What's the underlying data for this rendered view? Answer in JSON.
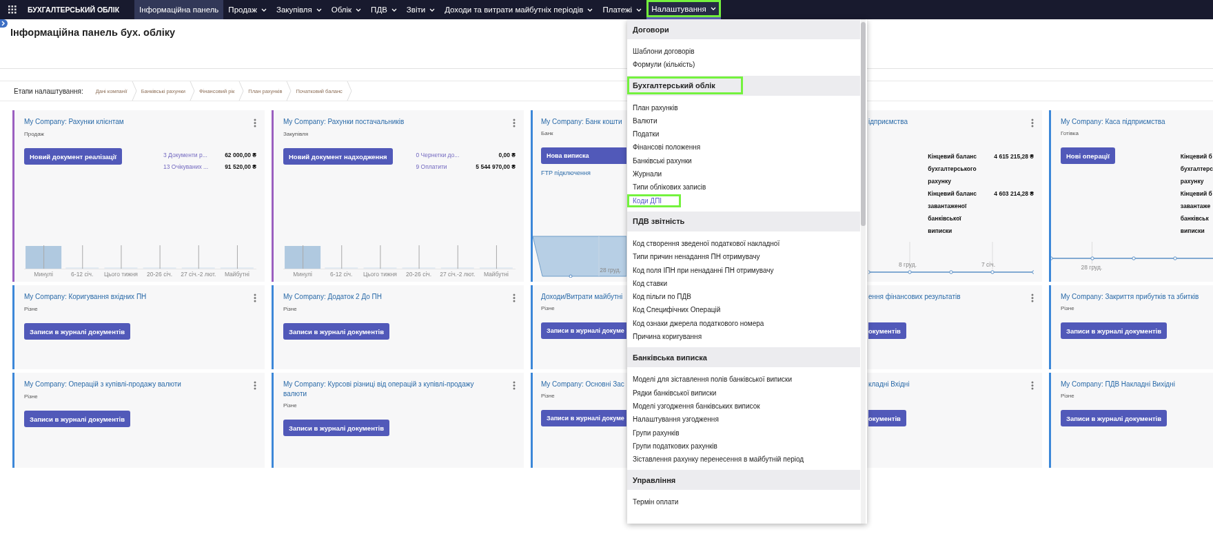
{
  "navbar": {
    "brand": "БУХГАЛТЕРСЬКИЙ ОБЛІК",
    "items": [
      {
        "label": "Інформаційна панель",
        "selected": true,
        "open": false,
        "dropdown": false,
        "highlighted": false
      },
      {
        "label": "Продаж",
        "selected": false,
        "open": false,
        "dropdown": true,
        "highlighted": false
      },
      {
        "label": "Закупівля",
        "selected": false,
        "open": false,
        "dropdown": true,
        "highlighted": false
      },
      {
        "label": "Облік",
        "selected": false,
        "open": false,
        "dropdown": true,
        "highlighted": false
      },
      {
        "label": "ПДВ",
        "selected": false,
        "open": false,
        "dropdown": true,
        "highlighted": false
      },
      {
        "label": "Звіти",
        "selected": false,
        "open": false,
        "dropdown": true,
        "highlighted": false
      },
      {
        "label": "Доходи та витрати майбутніх періодів",
        "selected": false,
        "open": false,
        "dropdown": true,
        "highlighted": false
      },
      {
        "label": "Платежі",
        "selected": false,
        "open": false,
        "dropdown": true,
        "highlighted": false
      },
      {
        "label": "Налаштування",
        "selected": false,
        "open": true,
        "dropdown": true,
        "highlighted": true
      }
    ]
  },
  "header": {
    "title": "Інформаційна панель бух. обліку"
  },
  "setup_steps": {
    "label": "Етапи налаштування:",
    "steps": [
      "Дані компанії",
      "Банківські рахунки",
      "Фінансовий рік",
      "План рахунків",
      "Початковий баланс"
    ]
  },
  "cards": [
    {
      "kind": "sales",
      "title": "My Company: Рахунки клієнтам",
      "subtitle": "Продаж",
      "color": "#9b5fc0",
      "menu": true,
      "button": "Новий документ реалізації",
      "links": [
        {
          "label": "3 Документи р...",
          "amount": "62 000,00 ₴"
        },
        {
          "label": "13 Очікуваних ...",
          "amount": "91 520,00 ₴"
        }
      ],
      "chart_labels": [
        "Минулі",
        "6-12 січ.",
        "Цього тижня",
        "20-26 січ.",
        "27 січ.-2 лют.",
        "Майбутні"
      ]
    },
    {
      "kind": "sales",
      "title": "My Company: Рахунки постачальників",
      "subtitle": "Закупівля",
      "color": "#9b5fc0",
      "menu": true,
      "button": "Новий документ надходження",
      "links": [
        {
          "label": "0 Чернетки до...",
          "amount": "0,00 ₴"
        },
        {
          "label": "9 Оплатити",
          "amount": "5 544 970,00 ₴"
        }
      ],
      "chart_labels": [
        "Минулі",
        "6-12 січ.",
        "Цього тижня",
        "20-26 січ.",
        "27 січ.-2 лют.",
        "Майбутні"
      ]
    },
    {
      "kind": "bank",
      "title": "My Company: Банк кошти",
      "subtitle": "Банк",
      "color": "#3c87d8",
      "menu": false,
      "button": "Нова виписка",
      "link": "FTP підключення",
      "chart_labels": [
        "28 груд."
      ]
    },
    {
      "kind": "balance",
      "title": "ідприємства",
      "menu": true,
      "balances": [
        {
          "label_lines": [
            "Кінцевий баланс",
            "бухгалтерського",
            "рахунку"
          ],
          "amount": "4 615 215,28 ₴"
        },
        {
          "label_lines": [
            "Кінцевий баланс",
            "завантаженої",
            "банківської",
            "виписки"
          ],
          "amount": "4 603 214,28 ₴"
        }
      ],
      "chart_labels": [
        "8 груд.",
        "7 січ."
      ]
    },
    {
      "kind": "cash",
      "title": "My Company: Каса підприємства",
      "subtitle": "Готівка",
      "color": "#3c87d8",
      "menu": false,
      "button": "Нові операції",
      "balances": [
        {
          "label_lines": [
            "Кінцевий б",
            "бухгалтерс",
            "рахунку"
          ]
        },
        {
          "label_lines": [
            "Кінцевий б",
            "завантаже",
            "банківськ",
            "виписки"
          ]
        }
      ],
      "chart_labels": [
        "28 груд."
      ]
    },
    {
      "kind": "journal",
      "title": "My Company: Коригування вхідних ПН",
      "subtitle": "Різне",
      "color": "#3c87d8",
      "menu": true,
      "button": "Записи в журналі документів"
    },
    {
      "kind": "journal",
      "title": "My Company: Додаток 2 До ПН",
      "subtitle": "Різне",
      "color": "#3c87d8",
      "menu": true,
      "button": "Записи в журналі документів"
    },
    {
      "kind": "journal",
      "title": "Доходи/Витрати майбутні",
      "subtitle": "Різне",
      "color": "#3c87d8",
      "menu": false,
      "button": "Записи в журналі докуме"
    },
    {
      "kind": "journal",
      "title": "ення фінансових результатів",
      "menu": true,
      "button": "окументів"
    },
    {
      "kind": "journal",
      "title": "My Company: Закриття прибутків та збитків",
      "subtitle": "Різне",
      "color": "#3c87d8",
      "menu": false,
      "button": "Записи в журналі документів"
    },
    {
      "kind": "journal",
      "title": "My Company: Операцій з купівлі-продажу валюти",
      "subtitle": "Різне",
      "color": "#3c87d8",
      "menu": true,
      "button": "Записи в журналі документів"
    },
    {
      "kind": "journal",
      "title": "My Company: Курсові різниці від операцій з купівлі-продажу валюти",
      "subtitle": "Різне",
      "color": "#3c87d8",
      "menu": true,
      "button": "Записи в журналі документів"
    },
    {
      "kind": "journal",
      "title": "My Company: Основні Зас",
      "subtitle": "Різне",
      "color": "#3c87d8",
      "menu": false,
      "button": "Записи в журналі докуме"
    },
    {
      "kind": "journal",
      "title": "кладні Вхідні",
      "menu": true,
      "button": "окументів"
    },
    {
      "kind": "journal",
      "title": "My Company: ПДВ Накладні Вихідні",
      "subtitle": "Різне",
      "color": "#3c87d8",
      "menu": false,
      "button": "Записи в журналі документів"
    }
  ],
  "dropdown": {
    "sections": [
      {
        "title": "Договори",
        "highlighted": false,
        "items": [
          {
            "label": "Шаблони договорів",
            "active": false,
            "highlighted": false
          },
          {
            "label": "Формули (кількість)",
            "active": false,
            "highlighted": false
          }
        ]
      },
      {
        "title": "Бухгалтерський облік",
        "highlighted": true,
        "items": [
          {
            "label": "План рахунків",
            "active": false,
            "highlighted": false
          },
          {
            "label": "Валюти",
            "active": false,
            "highlighted": false
          },
          {
            "label": "Податки",
            "active": false,
            "highlighted": false
          },
          {
            "label": "Фінансові положення",
            "active": false,
            "highlighted": false
          },
          {
            "label": "Банківські рахунки",
            "active": false,
            "highlighted": false
          },
          {
            "label": "Журнали",
            "active": false,
            "highlighted": false
          },
          {
            "label": "Типи облікових записів",
            "active": false,
            "highlighted": false
          },
          {
            "label": "Коди ДПІ",
            "active": true,
            "highlighted": true
          }
        ]
      },
      {
        "title": "ПДВ звітність",
        "highlighted": false,
        "items": [
          {
            "label": "Код створення зведеної податкової накладної",
            "active": false,
            "highlighted": false
          },
          {
            "label": "Типи причин ненадання ПН отримувачу",
            "active": false,
            "highlighted": false
          },
          {
            "label": "Код поля ІПН при ненаданні ПН отримувачу",
            "active": false,
            "highlighted": false
          },
          {
            "label": "Код ставки",
            "active": false,
            "highlighted": false
          },
          {
            "label": "Код пільги по ПДВ",
            "active": false,
            "highlighted": false
          },
          {
            "label": "Код Специфічних Операцій",
            "active": false,
            "highlighted": false
          },
          {
            "label": "Код ознаки джерела податкового номера",
            "active": false,
            "highlighted": false
          },
          {
            "label": "Причина коригування",
            "active": false,
            "highlighted": false
          }
        ]
      },
      {
        "title": "Банківська виписка",
        "highlighted": false,
        "items": [
          {
            "label": "Моделі для зіставлення полів банківської виписки",
            "active": false,
            "highlighted": false
          },
          {
            "label": "Рядки банківської виписки",
            "active": false,
            "highlighted": false
          },
          {
            "label": "Моделі узгодження банківських виписок",
            "active": false,
            "highlighted": false
          },
          {
            "label": "Налаштування узгодження",
            "active": false,
            "highlighted": false
          },
          {
            "label": "Групи рахунків",
            "active": false,
            "highlighted": false
          },
          {
            "label": "Групи податкових рахунків",
            "active": false,
            "highlighted": false
          },
          {
            "label": "Зіставлення рахунку перенесення в майбутній період",
            "active": false,
            "highlighted": false
          }
        ]
      },
      {
        "title": "Управління",
        "highlighted": false,
        "items": [
          {
            "label": "Термін оплати",
            "active": false,
            "highlighted": false
          }
        ]
      }
    ]
  }
}
